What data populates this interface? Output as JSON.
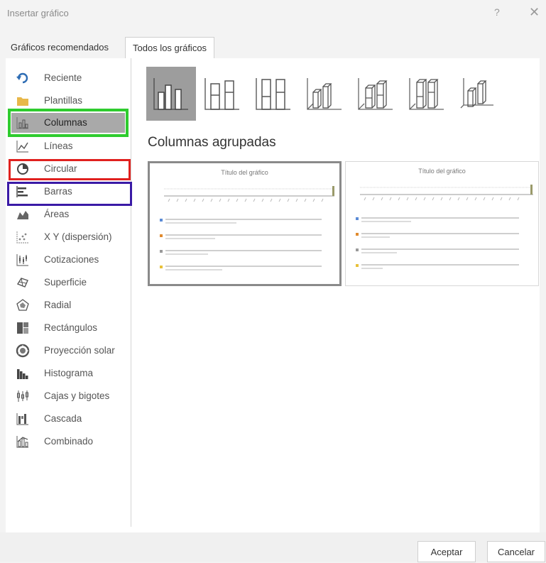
{
  "dialog": {
    "title": "Insertar gráfico",
    "help_glyph": "?",
    "close_glyph": "✕"
  },
  "tabs": [
    {
      "label": "Gráficos recomendados",
      "active": false
    },
    {
      "label": "Todos los gráficos",
      "active": true
    }
  ],
  "categories": [
    {
      "label": "Reciente",
      "icon": "recent-icon"
    },
    {
      "label": "Plantillas",
      "icon": "folder-icon"
    },
    {
      "label": "Columnas",
      "icon": "column-chart-icon",
      "selected": true
    },
    {
      "label": "Líneas",
      "icon": "line-chart-icon"
    },
    {
      "label": "Circular",
      "icon": "pie-chart-icon"
    },
    {
      "label": "Barras",
      "icon": "bar-chart-icon"
    },
    {
      "label": "Áreas",
      "icon": "area-chart-icon"
    },
    {
      "label": "X Y (dispersión)",
      "icon": "scatter-chart-icon"
    },
    {
      "label": "Cotizaciones",
      "icon": "stock-chart-icon"
    },
    {
      "label": "Superficie",
      "icon": "surface-chart-icon"
    },
    {
      "label": "Radial",
      "icon": "radar-chart-icon"
    },
    {
      "label": "Rectángulos",
      "icon": "treemap-chart-icon"
    },
    {
      "label": "Proyección solar",
      "icon": "sunburst-chart-icon"
    },
    {
      "label": "Histograma",
      "icon": "histogram-chart-icon"
    },
    {
      "label": "Cajas y bigotes",
      "icon": "box-whisker-chart-icon"
    },
    {
      "label": "Cascada",
      "icon": "waterfall-chart-icon"
    },
    {
      "label": "Combinado",
      "icon": "combo-chart-icon"
    }
  ],
  "subtype": {
    "heading": "Columnas agrupadas"
  },
  "previews": [
    {
      "title": "Título del gráfico"
    },
    {
      "title": "Título del gráfico"
    }
  ],
  "buttons": {
    "ok": "Aceptar",
    "cancel": "Cancelar"
  },
  "colors": {
    "selected_bg": "#a9a9a9",
    "highlight_green": "#2ecc2e",
    "highlight_red": "#e0211f",
    "highlight_blue": "#3a1aa6"
  }
}
